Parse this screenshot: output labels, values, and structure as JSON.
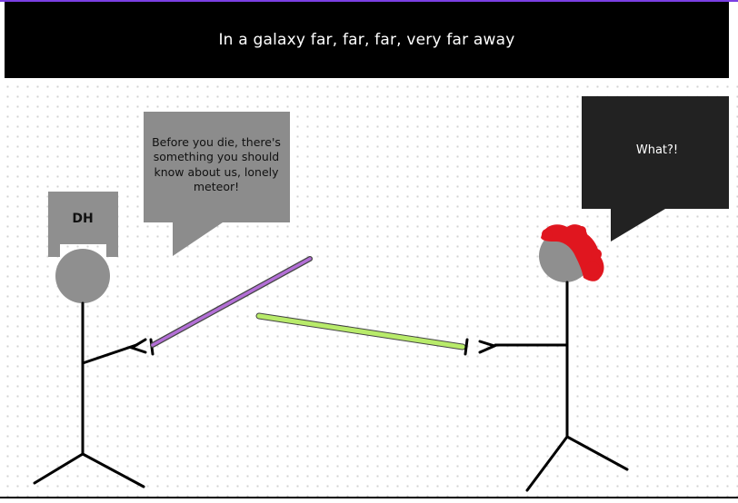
{
  "title": "In a galaxy far, far, far, very far away",
  "left_character": {
    "hat_label": "DH",
    "speech": "Before you die, there's something you should know about us, lonely meteor!"
  },
  "right_character": {
    "speech": "What?!"
  },
  "colors": {
    "banner": "#000000",
    "title_text": "#ffffff",
    "left_bubble": "#8c8c8c",
    "right_bubble": "#222222",
    "head": "#8f8f8f",
    "purple_saber": "#b36fd6",
    "green_saber": "#b8eb6a",
    "hair": "#e0161f",
    "accent": "#7b3fe4"
  }
}
